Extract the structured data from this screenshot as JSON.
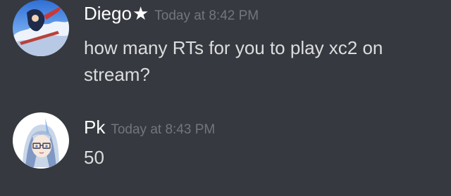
{
  "messages": [
    {
      "author": "Diego",
      "author_badge": "★",
      "timestamp": "Today at 8:42 PM",
      "content": "how many RTs for you to play xc2 on stream?",
      "avatar": "diego-avatar"
    },
    {
      "author": "Pk",
      "timestamp": "Today at 8:43 PM",
      "content": "50",
      "avatar": "pk-avatar"
    }
  ],
  "colors": {
    "background": "#36393f",
    "username": "#ffffff",
    "timestamp": "#72767d",
    "message_text": "#dcddde"
  }
}
